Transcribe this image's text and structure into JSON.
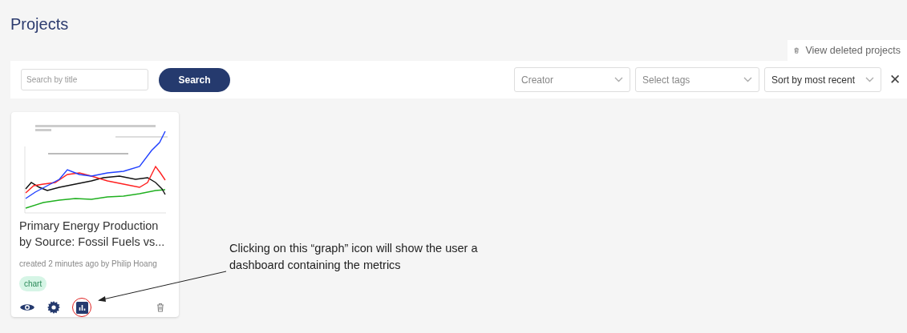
{
  "page_title": "Projects",
  "deleted_link": {
    "label": "View deleted projects"
  },
  "filters": {
    "search": {
      "placeholder": "Search by title"
    },
    "search_button": "Search",
    "dropdowns": [
      {
        "placeholder": "Creator",
        "selected": false
      },
      {
        "placeholder": "Select tags",
        "selected": false
      },
      {
        "placeholder": "Sort by most recent",
        "selected": true
      }
    ],
    "clear": "✕"
  },
  "projects": [
    {
      "title": "Primary Energy Production by Source: Fossil Fuels vs...",
      "meta": "created 2 minutes ago by Philip Hoang",
      "tags": [
        "chart"
      ]
    }
  ],
  "annotation": {
    "text": "Clicking on this “graph” icon will show the user a dashboard containing the metrics"
  }
}
